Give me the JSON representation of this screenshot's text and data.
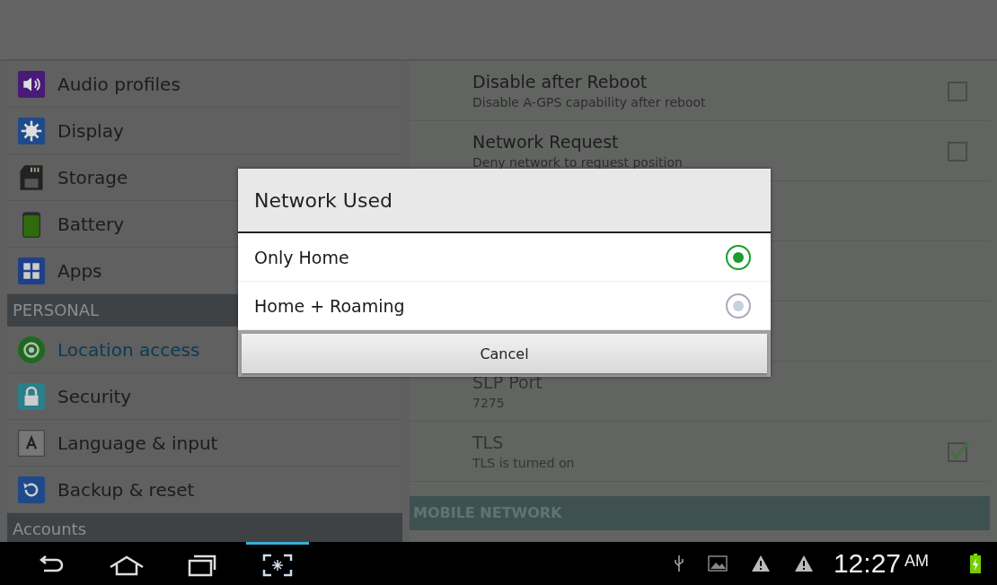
{
  "sidebar": {
    "items": [
      {
        "kind": "item",
        "label": "Audio profiles",
        "selected": false
      },
      {
        "kind": "item",
        "label": "Display",
        "selected": false
      },
      {
        "kind": "item",
        "label": "Storage",
        "selected": false
      },
      {
        "kind": "item",
        "label": "Battery",
        "selected": false
      },
      {
        "kind": "item",
        "label": "Apps",
        "selected": false
      },
      {
        "kind": "header",
        "label": "PERSONAL"
      },
      {
        "kind": "item",
        "label": "Location access",
        "selected": true
      },
      {
        "kind": "item",
        "label": "Security",
        "selected": false
      },
      {
        "kind": "item",
        "label": "Language & input",
        "selected": false
      },
      {
        "kind": "item",
        "label": "Backup & reset",
        "selected": false
      },
      {
        "kind": "header",
        "label": "Accounts"
      }
    ]
  },
  "settings": {
    "rows": [
      {
        "kind": "row",
        "title": "Disable after Reboot",
        "summary": "Disable A-GPS capability after reboot",
        "checked": false,
        "disabled": false
      },
      {
        "kind": "row",
        "title": "Network Request",
        "summary": "Deny network to request position",
        "checked": false,
        "disabled": false
      },
      {
        "kind": "hidden"
      },
      {
        "kind": "hidden"
      },
      {
        "kind": "hidden"
      },
      {
        "kind": "row",
        "title": "SLP Port",
        "summary": "7275",
        "disabled": true
      },
      {
        "kind": "row",
        "title": "TLS",
        "summary": "TLS is turned on",
        "checked": true,
        "disabled": true
      },
      {
        "kind": "header",
        "title": "MOBILE NETWORK"
      }
    ]
  },
  "dialog": {
    "title": "Network Used",
    "options": [
      {
        "label": "Only Home",
        "selected": true
      },
      {
        "label": "Home + Roaming",
        "selected": false
      }
    ],
    "cancel": "Cancel"
  },
  "nav_bar": {
    "buttons": [
      {
        "selected": false
      },
      {
        "selected": false
      },
      {
        "selected": false
      },
      {
        "selected": true
      }
    ],
    "clock": "12:27",
    "ampm": "AM"
  }
}
